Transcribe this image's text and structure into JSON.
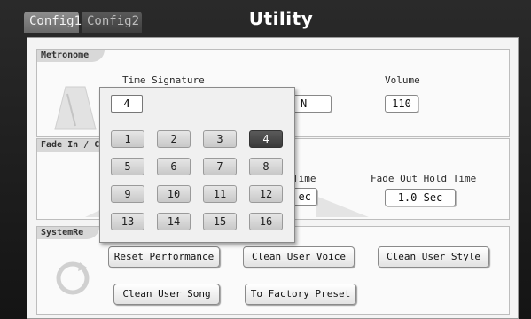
{
  "header": {
    "tabs": [
      {
        "label": "Config1",
        "active": true
      },
      {
        "label": "Config2",
        "active": false
      }
    ],
    "title": "Utility"
  },
  "metronome": {
    "section_label": "Metronome",
    "time_signature_label": "Time Signature",
    "time_signature_value_partial": "N",
    "volume_label": "Volume",
    "volume_value": "110"
  },
  "fade": {
    "section_label": "Fade In / C",
    "fade_in_time_label_partial": "Time",
    "fade_in_time_value_partial": "ec",
    "fade_out_hold_label": "Fade Out Hold Time",
    "fade_out_hold_value": "1.0 Sec"
  },
  "system": {
    "section_label": "SystemRe",
    "buttons": [
      "Reset Performance",
      "Clean User Voice",
      "Clean User Style",
      "Clean User Song",
      "To Factory Preset"
    ]
  },
  "popup": {
    "value": "4",
    "keys": [
      "1",
      "2",
      "3",
      "4",
      "5",
      "6",
      "7",
      "8",
      "9",
      "10",
      "11",
      "12",
      "13",
      "14",
      "15",
      "16"
    ],
    "selected_key": "4"
  }
}
